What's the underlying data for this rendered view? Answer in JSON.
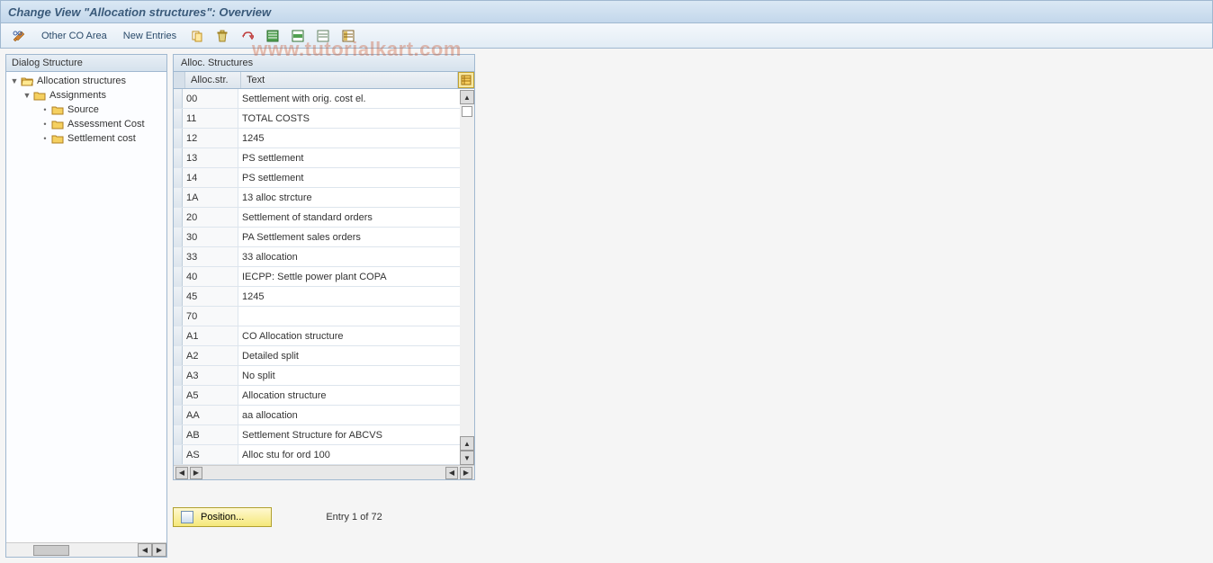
{
  "title": "Change View \"Allocation structures\": Overview",
  "toolbar": {
    "other_co_area": "Other CO Area",
    "new_entries": "New Entries"
  },
  "dialog_structure": {
    "header": "Dialog Structure",
    "items": [
      {
        "label": "Allocation structures",
        "level": 0,
        "expanded": true,
        "open": true
      },
      {
        "label": "Assignments",
        "level": 1,
        "expanded": true,
        "open": false
      },
      {
        "label": "Source",
        "level": 2,
        "expanded": false,
        "open": false
      },
      {
        "label": "Assessment Cost",
        "level": 2,
        "expanded": false,
        "open": false
      },
      {
        "label": "Settlement cost",
        "level": 2,
        "expanded": false,
        "open": false
      }
    ]
  },
  "table": {
    "title": "Alloc. Structures",
    "col_code": "Alloc.str.",
    "col_text": "Text",
    "rows": [
      {
        "code": "00",
        "text": "Settlement with orig. cost el."
      },
      {
        "code": "11",
        "text": "TOTAL COSTS"
      },
      {
        "code": "12",
        "text": "1245"
      },
      {
        "code": "13",
        "text": "PS settlement"
      },
      {
        "code": "14",
        "text": "PS settlement"
      },
      {
        "code": "1A",
        "text": "13 alloc strcture"
      },
      {
        "code": "20",
        "text": "Settlement of standard orders"
      },
      {
        "code": "30",
        "text": "PA Settlement sales orders"
      },
      {
        "code": "33",
        "text": "33 allocation"
      },
      {
        "code": "40",
        "text": "IECPP: Settle power plant COPA"
      },
      {
        "code": "45",
        "text": "1245"
      },
      {
        "code": "70",
        "text": ""
      },
      {
        "code": "A1",
        "text": "CO Allocation structure"
      },
      {
        "code": "A2",
        "text": "Detailed split"
      },
      {
        "code": "A3",
        "text": "No split"
      },
      {
        "code": "A5",
        "text": "Allocation structure"
      },
      {
        "code": "AA",
        "text": "aa allocation"
      },
      {
        "code": "AB",
        "text": "Settlement Structure for ABCVS"
      },
      {
        "code": "AS",
        "text": "Alloc stu for ord 100"
      }
    ]
  },
  "footer": {
    "position_btn": "Position...",
    "entry_text": "Entry 1 of 72"
  },
  "watermark": "www.tutorialkart.com"
}
